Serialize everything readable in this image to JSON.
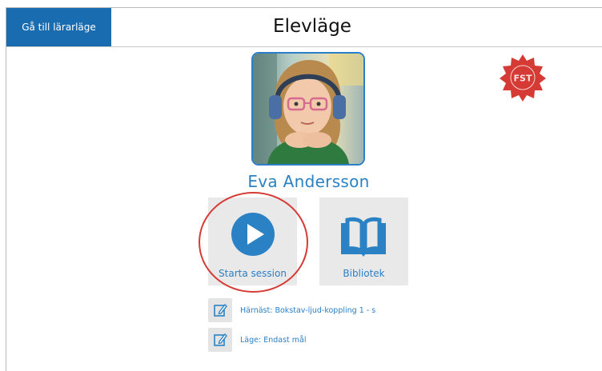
{
  "header": {
    "teacher_mode_button": "Gå till lärarläge",
    "title": "Elevläge"
  },
  "badge": {
    "text": "FST",
    "color": "#d63a35"
  },
  "student": {
    "name": "Eva Andersson"
  },
  "actions": {
    "start_session": {
      "label": "Starta session",
      "icon": "play-icon"
    },
    "library": {
      "label": "Bibliotek",
      "icon": "book-icon"
    }
  },
  "info": {
    "next": "Härnäst: Bokstav-ljud-koppling 1 - s",
    "mode": "Läge: Endast mål"
  },
  "colors": {
    "accent": "#2a7fc6",
    "header_button": "#1a6cb0",
    "highlight": "#d63a35"
  }
}
